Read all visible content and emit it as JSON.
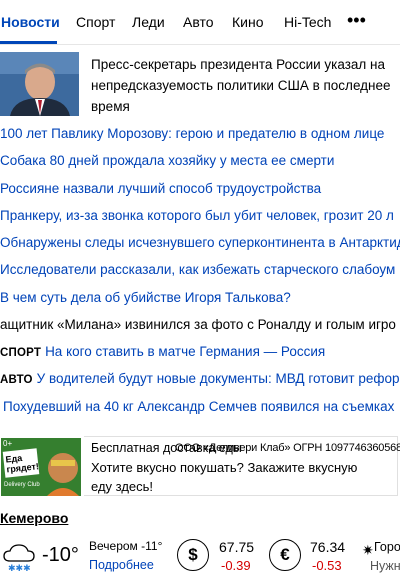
{
  "tabs": [
    {
      "label": "Новости",
      "active": true
    },
    {
      "label": "Спорт"
    },
    {
      "label": "Леди"
    },
    {
      "label": "Авто"
    },
    {
      "label": "Кино"
    },
    {
      "label": "Hi-Tech"
    }
  ],
  "more_icon": "more-dots-icon",
  "top_story": {
    "text": "Пресс-секретарь президента России указал на непредсказуемость политики США в последнее время"
  },
  "news": [
    {
      "text": "100 лет Павлику Морозову: герою и предателю в одном лице"
    },
    {
      "text": "Собака 80 дней прождала хозяйку у места ее смерти"
    },
    {
      "text": "Россияне назвали лучший способ трудоустройства"
    },
    {
      "text": "Пранкеру, из-за звонка которого был убит человек, грозит 20 л"
    },
    {
      "text": "Обнаружены следы исчезнувшего суперконтинента в Антарктид"
    },
    {
      "text": "Исследователи рассказали, как избежать старческого слабоум"
    },
    {
      "text": "В чем суть дела об убийстве Игоря Талькова?"
    },
    {
      "text": "ащитник «Милана» извинился за фото с Роналду и голым игро"
    },
    {
      "tag": "Спорт",
      "text": "На кого ставить в матче Германия — Россия"
    },
    {
      "tag": "Авто",
      "text": "У водителей будут новые документы: МВД готовит рефор"
    },
    {
      "text": "Похудевший на 40 кг Александр Семчев появился на съемках"
    }
  ],
  "ad": {
    "image_text": "Еда грядет!",
    "image_brand": "Delivery Club",
    "image_badge": "0+",
    "title": "Бесплатная доставка еды",
    "legal": "ООО «Деливери Клаб» ОГРН 1097746360568",
    "body": "Хотите вкусно покушать? Закажите вкусную еду здесь!"
  },
  "city": "Кемерово",
  "weather": {
    "icon": "cloud-snow-icon",
    "temp": "-10°",
    "evening": "Вечером -11°",
    "more_link": "Подробнее"
  },
  "currency": [
    {
      "symbol": "$",
      "icon": "dollar-icon",
      "value": "67.75",
      "change": "-0.39"
    },
    {
      "symbol": "€",
      "icon": "euro-icon",
      "value": "76.34",
      "change": "-0.53"
    }
  ],
  "extra": {
    "icon": "sun-icon",
    "label": "Горо",
    "sub": "Нужна"
  },
  "colors": {
    "accent": "#0046b8",
    "link": "#0043b8",
    "negative": "#d40000"
  }
}
